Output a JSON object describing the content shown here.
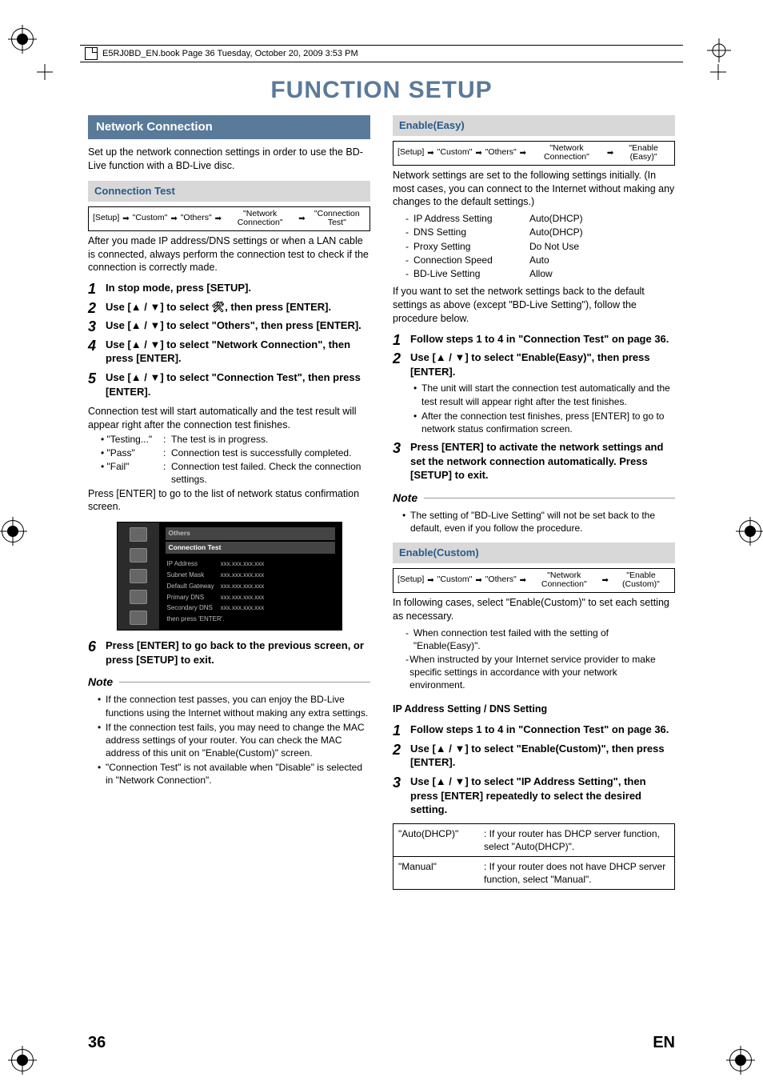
{
  "book_header": "E5RJ0BD_EN.book  Page 36  Tuesday, October 20, 2009  3:53 PM",
  "page_title": "FUNCTION SETUP",
  "left": {
    "section_title": "Network Connection",
    "intro": "Set up the network connection settings in order to use the BD-Live function with a BD-Live disc.",
    "sub1_title": "Connection Test",
    "path1": [
      "[Setup]",
      "\"Custom\"",
      "\"Others\"",
      "\"Network Connection\"",
      "\"Connection Test\""
    ],
    "after_path": "After you made IP address/DNS settings or when a LAN cable is connected, always perform the connection test to check if the connection is correctly made.",
    "steps": [
      "In stop mode, press [SETUP].",
      "Use [▲ / ▼] to select 🛠, then press [ENTER].",
      "Use [▲ / ▼] to select \"Others\", then press [ENTER].",
      "Use [▲ / ▼] to select \"Network Connection\", then press [ENTER].",
      "Use [▲ / ▼] to select \"Connection Test\", then press [ENTER]."
    ],
    "test_intro": "Connection test will start automatically and the test result will appear right after the connection test finishes.",
    "test_status": [
      {
        "k": "\"Testing...\"",
        "v": "The test is in progress."
      },
      {
        "k": "\"Pass\"",
        "v": "Connection test is successfully completed."
      },
      {
        "k": "\"Fail\"",
        "v": "Connection test failed. Check the connection settings."
      }
    ],
    "press_enter_list": " Press [ENTER] to go to the list of network status confirmation screen.",
    "osd": {
      "bar1": "Others",
      "bar2": "Connection Test",
      "rows": [
        [
          "IP Address",
          "xxx.xxx.xxx.xxx"
        ],
        [
          "Subnet Mask",
          "xxx.xxx.xxx.xxx"
        ],
        [
          "Default Gateway",
          "xxx.xxx.xxx.xxx"
        ],
        [
          "Primary DNS",
          "xxx.xxx.xxx.xxx"
        ],
        [
          "Secondary DNS",
          "xxx.xxx.xxx.xxx"
        ]
      ],
      "footer": "then press 'ENTER'."
    },
    "step6": "Press [ENTER] to go back to the previous screen, or press [SETUP] to exit.",
    "note_title": "Note",
    "notes": [
      "If the connection test passes, you can enjoy the BD-Live functions using the Internet without making any extra settings.",
      "If the connection test fails, you may need to change the MAC address settings of your router. You can check the MAC address of this unit on \"Enable(Custom)\" screen.",
      "\"Connection Test\" is not available when \"Disable\" is selected in \"Network Connection\"."
    ]
  },
  "right": {
    "sub_easy": "Enable(Easy)",
    "path_easy": [
      "[Setup]",
      "\"Custom\"",
      "\"Others\"",
      "\"Network Connection\"",
      "\"Enable (Easy)\""
    ],
    "easy_intro": "Network settings are set to the following settings initially. (In most cases, you can connect to the Internet without making any changes to the default settings.)",
    "defaults": [
      [
        "IP Address Setting",
        "Auto(DHCP)"
      ],
      [
        "DNS Setting",
        "Auto(DHCP)"
      ],
      [
        "Proxy Setting",
        "Do Not Use"
      ],
      [
        "Connection Speed",
        "Auto"
      ],
      [
        "BD-Live Setting",
        "Allow"
      ]
    ],
    "easy_back": "If you want to set the network settings back to the default settings as above (except \"BD-Live Setting\"), follow the procedure below.",
    "easy_steps": [
      "Follow steps 1 to 4 in \"Connection Test\" on page 36.",
      "Use [▲ / ▼] to select \"Enable(Easy)\", then press [ENTER].",
      "Press [ENTER] to activate the network settings and set the network connection automatically. Press [SETUP] to exit."
    ],
    "easy_sub_bullets": [
      "The unit will start the connection test automatically and the test result will appear right after the test finishes.",
      "After the connection test finishes, press [ENTER] to go to network status confirmation screen."
    ],
    "easy_note_title": "Note",
    "easy_note": "The setting of \"BD-Live Setting\" will not be set back to the default, even if you follow the procedure.",
    "sub_custom": "Enable(Custom)",
    "path_custom": [
      "[Setup]",
      "\"Custom\"",
      "\"Others\"",
      "\"Network Connection\"",
      "\"Enable (Custom)\""
    ],
    "custom_intro": "In following cases, select \"Enable(Custom)\" to set each setting as necessary.",
    "custom_cases": [
      "When connection test failed with the setting of \"Enable(Easy)\".",
      "When instructed by your Internet service provider to make specific settings in accordance with your network environment."
    ],
    "ipdns_title": "IP Address Setting / DNS Setting",
    "custom_steps": [
      "Follow steps 1 to 4 in \"Connection Test\" on page 36.",
      "Use [▲ / ▼] to select \"Enable(Custom)\", then press [ENTER].",
      "Use [▲ / ▼] to select \"IP Address Setting\", then press [ENTER] repeatedly to select the desired setting."
    ],
    "ip_table": [
      [
        "\"Auto(DHCP)\"",
        ": If your router has DHCP server function, select \"Auto(DHCP)\"."
      ],
      [
        "\"Manual\"",
        ": If your router does not have DHCP server function, select \"Manual\"."
      ]
    ]
  },
  "footer": {
    "page": "36",
    "lang": "EN"
  }
}
